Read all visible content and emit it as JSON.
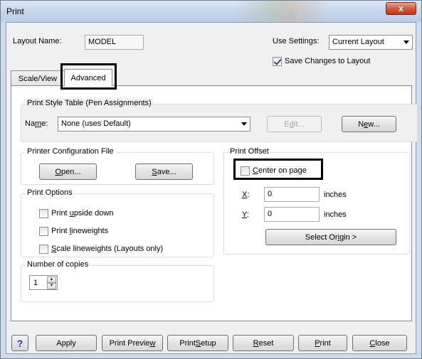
{
  "window": {
    "title": "Print",
    "close_glyph": "x"
  },
  "layout": {
    "label": "Layout Name:",
    "value": "MODEL"
  },
  "use_settings": {
    "label": "Use Settings:",
    "value": "Current Layout"
  },
  "save_changes": {
    "label": "Save Changes to Layout",
    "checked": true
  },
  "tabs": [
    {
      "label": "Scale/View",
      "active": false
    },
    {
      "label": "Advanced",
      "active": true
    }
  ],
  "pen_table": {
    "group_title": "Print Style Table (Pen Assignments)",
    "name_label": "Name:",
    "name_value": "None (uses Default)",
    "edit_label": "Edit...",
    "new_label": "New..."
  },
  "printer_config": {
    "group_title": "Printer Configuration File",
    "open_label": "Open...",
    "save_label": "Save..."
  },
  "print_options": {
    "group_title": "Print Options",
    "items": [
      {
        "label": "Print upside down",
        "checked": false
      },
      {
        "label": "Print lineweights",
        "checked": false
      },
      {
        "label": "Scale lineweights (Layouts only)",
        "checked": false
      }
    ]
  },
  "copies": {
    "group_title": "Number of copies",
    "value": "1"
  },
  "print_offset": {
    "group_title": "Print Offset",
    "center_label": "Center on page",
    "center_checked": false,
    "x_label": "X:",
    "x_value": "0",
    "y_label": "Y:",
    "y_value": "0",
    "units": "inches",
    "select_origin_label": "Select Origin >"
  },
  "footer": {
    "help_label": "?",
    "apply": "Apply",
    "preview": "Print Preview",
    "setup": "Print Setup",
    "reset": "Reset",
    "print": "Print",
    "close": "Close"
  },
  "colors": {
    "titlebar": "#c6d7ec",
    "highlight": "#000000",
    "help_blue": "#1a3fa6"
  }
}
